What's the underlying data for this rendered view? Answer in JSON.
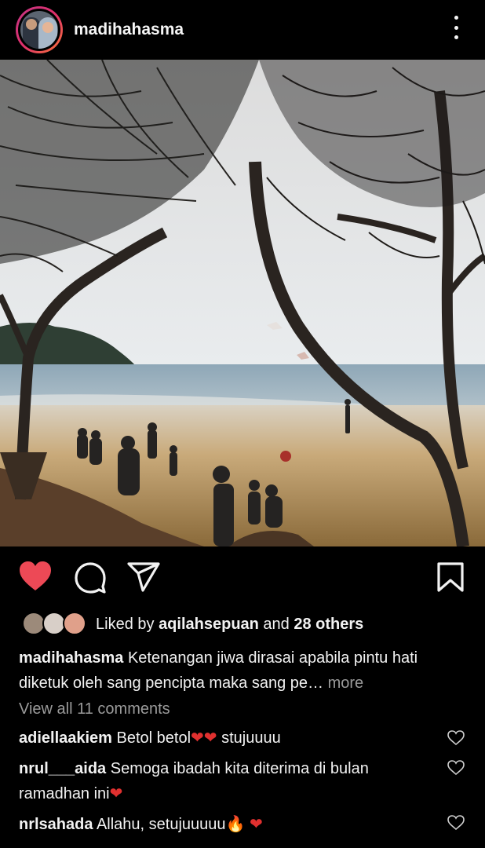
{
  "post": {
    "username": "madihahasma",
    "photo_alt": "Beach with trees, people and kite"
  },
  "actions": {
    "like": "heart-icon",
    "comment": "comment-icon",
    "share": "send-icon",
    "save": "bookmark-icon",
    "liked": true
  },
  "likes": {
    "prefix": "Liked by ",
    "user": "aqilahsepuan",
    "middle": " and ",
    "others": "28 others"
  },
  "caption": {
    "username": "madihahasma",
    "text": "Ketenangan jiwa dirasai apabila pintu hati diketuk oleh sang pencipta maka sang pe…",
    "more": "more"
  },
  "view_all_comments": "View all 11 comments",
  "comments": [
    {
      "user": "adiellaakiem",
      "text": "Betol betol",
      "emoji": "❤❤",
      "after": " stujuuuu"
    },
    {
      "user": "nrul___aida",
      "text": "Semoga ibadah kita diterima di bulan ramadhan ini",
      "emoji": "❤",
      "after": ""
    },
    {
      "user": "nrlsahada",
      "text": "Allahu, setujuuuuu",
      "emoji": "🔥 ❤",
      "after": ""
    }
  ],
  "colors": {
    "like_red": "#ed4956",
    "text": "#f2f2f2",
    "muted": "#9a9a9a",
    "background": "#000000"
  }
}
